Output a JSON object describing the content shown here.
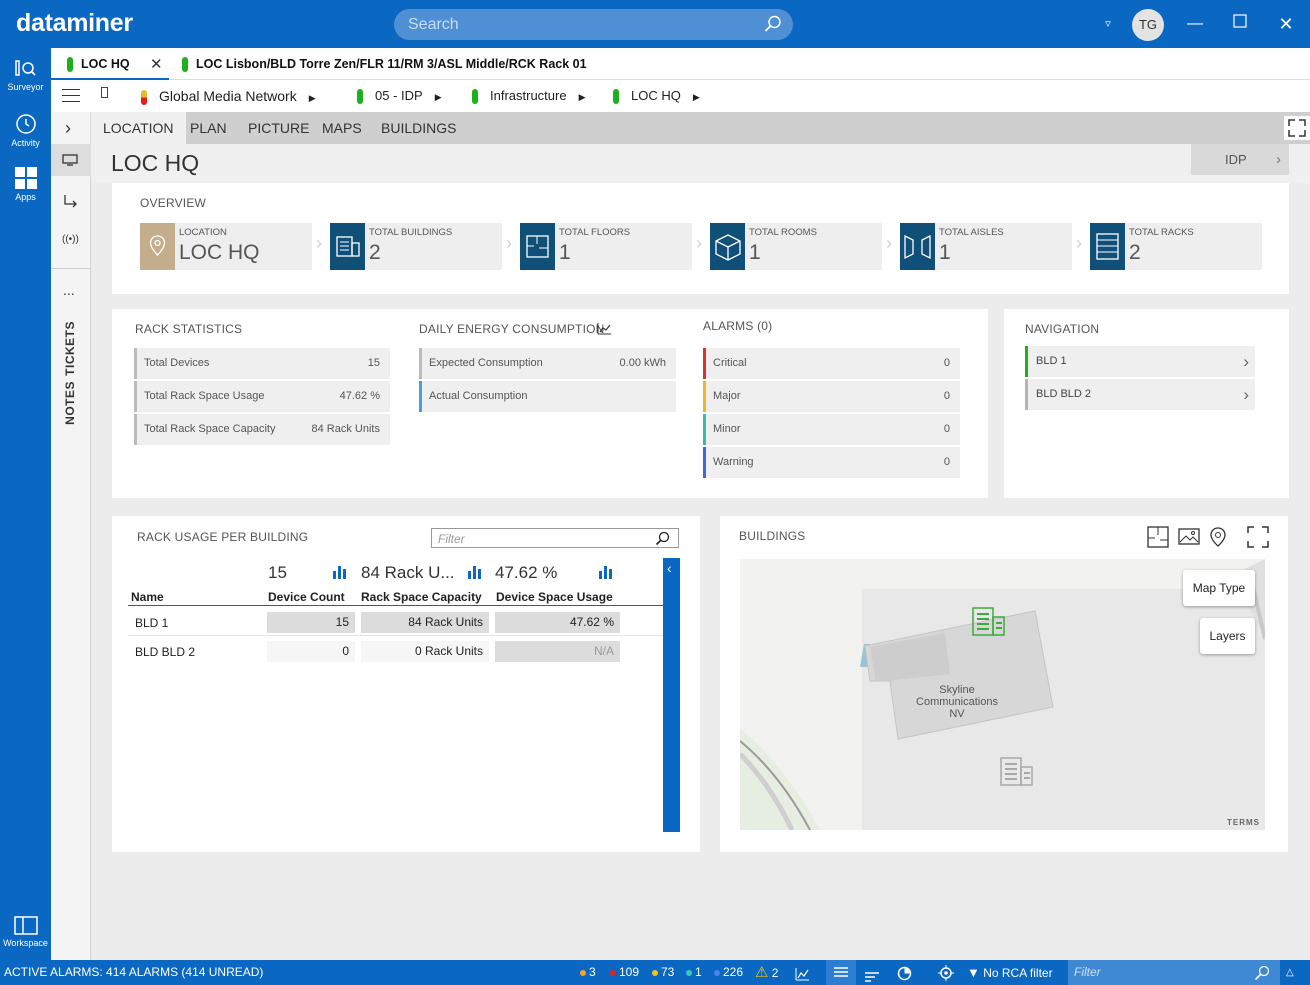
{
  "app": {
    "logo": "dataminer",
    "search_placeholder": "Search",
    "user_initials": "TG"
  },
  "leftbar": {
    "items": [
      {
        "label": "Surveyor"
      },
      {
        "label": "Activity"
      },
      {
        "label": "Apps"
      }
    ],
    "workspace": "Workspace"
  },
  "sidecol": {
    "more": "...",
    "tickets": "TICKETS",
    "notes": "NOTES"
  },
  "tabs": [
    {
      "label": "LOC HQ"
    },
    {
      "label": "LOC Lisbon/BLD Torre Zen/FLR 11/RM 3/ASL Middle/RCK Rack 01"
    }
  ],
  "breadcrumb": [
    "Global Media Network",
    "05 - IDP",
    "Infrastructure",
    "LOC HQ"
  ],
  "view_tabs": [
    "LOCATION",
    "PLAN",
    "PICTURE",
    "MAPS",
    "BUILDINGS"
  ],
  "page": {
    "title": "LOC HQ",
    "idp_button": "IDP"
  },
  "overview": {
    "heading": "OVERVIEW",
    "cards": [
      {
        "label": "LOCATION",
        "value": "LOC HQ",
        "icon": "location-pin-icon"
      },
      {
        "label": "TOTAL BUILDINGS",
        "value": "2",
        "icon": "building-icon"
      },
      {
        "label": "TOTAL FLOORS",
        "value": "1",
        "icon": "floorplan-icon"
      },
      {
        "label": "TOTAL ROOMS",
        "value": "1",
        "icon": "room-cube-icon"
      },
      {
        "label": "TOTAL AISLES",
        "value": "1",
        "icon": "aisle-icon"
      },
      {
        "label": "TOTAL RACKS",
        "value": "2",
        "icon": "rack-icon"
      }
    ]
  },
  "rack_stats": {
    "heading": "RACK STATISTICS",
    "rows": [
      {
        "label": "Total Devices",
        "value": "15"
      },
      {
        "label": "Total Rack Space Usage",
        "value": "47.62 %"
      },
      {
        "label": "Total Rack Space Capacity",
        "value": "84 Rack Units"
      }
    ]
  },
  "energy": {
    "heading": "DAILY ENERGY CONSUMPTION",
    "rows": [
      {
        "label": "Expected Consumption",
        "value": "0.00 kWh"
      },
      {
        "label": "Actual Consumption",
        "value": ""
      }
    ]
  },
  "alarms": {
    "heading": "ALARMS (0)",
    "rows": [
      {
        "label": "Critical",
        "value": "0",
        "color": "#d9312c"
      },
      {
        "label": "Major",
        "value": "0",
        "color": "#e8b923"
      },
      {
        "label": "Minor",
        "value": "0",
        "color": "#36b8b3"
      },
      {
        "label": "Warning",
        "value": "0",
        "color": "#3f68d8"
      }
    ]
  },
  "navigation": {
    "heading": "NAVIGATION",
    "items": [
      {
        "label": "BLD 1",
        "color": "#1bb11b"
      },
      {
        "label": "BLD BLD 2",
        "color": "#b5b5b5"
      }
    ]
  },
  "rack_usage": {
    "heading": "RACK USAGE PER BUILDING",
    "filter_placeholder": "Filter",
    "totals": [
      "15",
      "84 Rack U...",
      "47.62 %"
    ],
    "columns": [
      "Name",
      "Device Count",
      "Rack Space Capacity",
      "Device Space Usage"
    ],
    "rows": [
      {
        "name": "BLD 1",
        "devices": "15",
        "capacity": "84 Rack Units",
        "usage": "47.62 %"
      },
      {
        "name": "BLD BLD 2",
        "devices": "0",
        "capacity": "0 Rack Units",
        "usage": "N/A"
      }
    ]
  },
  "buildings": {
    "heading": "BUILDINGS",
    "map_type": "Map Type",
    "layers": "Layers",
    "map_label": "Skyline Communications NV",
    "terms": "TERMS"
  },
  "statusbar": {
    "active_alarms": "ACTIVE ALARMS: 414 ALARMS (414 UNREAD)",
    "counts": [
      {
        "value": "3",
        "color": "#f5a623"
      },
      {
        "value": "109",
        "color": "#e02020"
      },
      {
        "value": "73",
        "color": "#f5c518"
      },
      {
        "value": "1",
        "color": "#3cc6c0"
      },
      {
        "value": "226",
        "color": "#4a80f0"
      }
    ],
    "warning_count": "2",
    "rca": "No RCA filter",
    "filter_placeholder": "Filter"
  }
}
